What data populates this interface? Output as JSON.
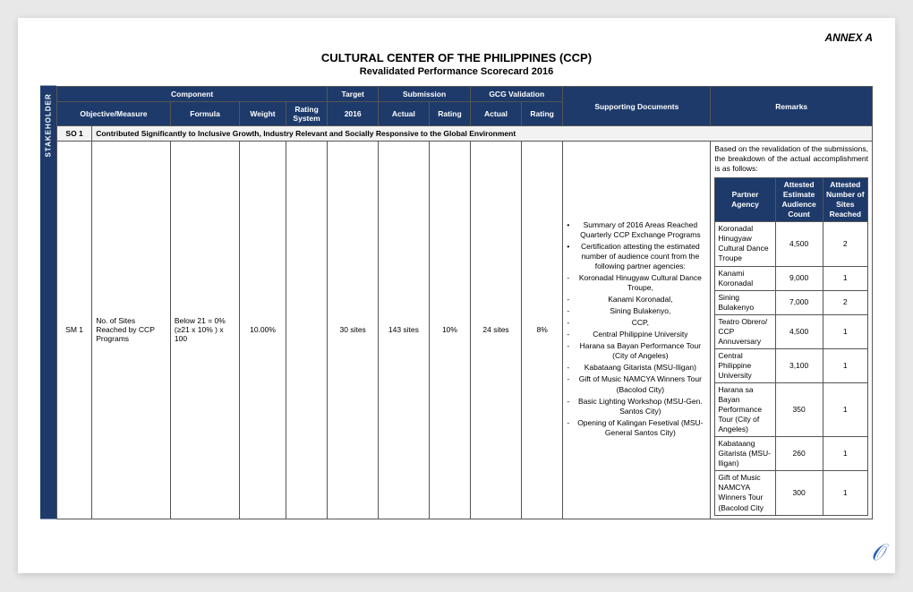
{
  "annex": "ANNEX A",
  "title_main": "CULTURAL CENTER OF THE PHILIPPINES (CCP)",
  "subtitle": "Revalidated Performance Scorecard 2016",
  "sidebar_label": "STAKEHOLDER",
  "headers": {
    "component": "Component",
    "target": "Target",
    "submission": "Submission",
    "gcg": "GCG Validation",
    "supporting": "Supporting Documents",
    "remarks": "Remarks",
    "objective": "Objective/Measure",
    "formula": "Formula",
    "weight": "Weight",
    "rating_system": "Rating System",
    "year": "2016",
    "actual": "Actual",
    "rating": "Rating"
  },
  "so": {
    "id": "SO 1",
    "desc": "Contributed Significantly to Inclusive Growth, Industry Relevant and Socially Responsive to the Global Environment"
  },
  "sm": {
    "id": "SM 1",
    "objective": "No. of Sites Reached by CCP Programs",
    "formula": "Below 21 = 0%\n(≥21 x 10% ) x 100",
    "weight": "10.00%",
    "rating_system": "",
    "target": "30 sites",
    "sub_actual": "143 sites",
    "sub_rating": "10%",
    "gcg_actual": "24 sites",
    "gcg_rating": "8%"
  },
  "docs": {
    "b1": "Summary of 2016 Areas Reached Quarterly CCP Exchange Programs",
    "b2": "Certification attesting the estimated number of audience count from the following partner agencies:",
    "d1": "Koronadal Hinugyaw Cultural Dance Troupe,",
    "d2": "Kanami Koronadal,",
    "d3": "Sining Bulakenyo,",
    "d4": "CCP,",
    "d5": "Central Philippine University",
    "d6": "Harana sa Bayan Performance Tour (City of Angeles)",
    "d7": "Kabataang Gitarista (MSU-Iligan)",
    "d8": "Gift of Music NAMCYA Winners Tour (Bacolod City)",
    "d9": "Basic Lighting Workshop (MSU-Gen. Santos City)",
    "d10": "Opening of Kalingan Fesetival (MSU-General Santos City)"
  },
  "remarks_intro": "Based on the revalidation of the submissions, the breakdown of the actual accomplishment is as follows:",
  "inner_headers": {
    "c1": "Partner Agency",
    "c2": "Attested Estimate Audience Count",
    "c3": "Attested Number of Sites Reached"
  },
  "inner_rows": [
    {
      "agency": "Koronadal Hinugyaw Cultural Dance Troupe",
      "count": "4,500",
      "sites": "2"
    },
    {
      "agency": "Kanami Koronadal",
      "count": "9,000",
      "sites": "1"
    },
    {
      "agency": "Sining Bulakenyo",
      "count": "7,000",
      "sites": "2"
    },
    {
      "agency": "Teatro Obrero/ CCP Annuversary",
      "count": "4,500",
      "sites": "1"
    },
    {
      "agency": "Central Philippine University",
      "count": "3,100",
      "sites": "1"
    },
    {
      "agency": "Harana sa Bayan Performance Tour (City of Angeles)",
      "count": "350",
      "sites": "1"
    },
    {
      "agency": "Kabataang Gitarista (MSU-Iligan)",
      "count": "260",
      "sites": "1"
    },
    {
      "agency": "Gift of Music NAMCYA Winners Tour (Bacolod City",
      "count": "300",
      "sites": "1"
    }
  ]
}
